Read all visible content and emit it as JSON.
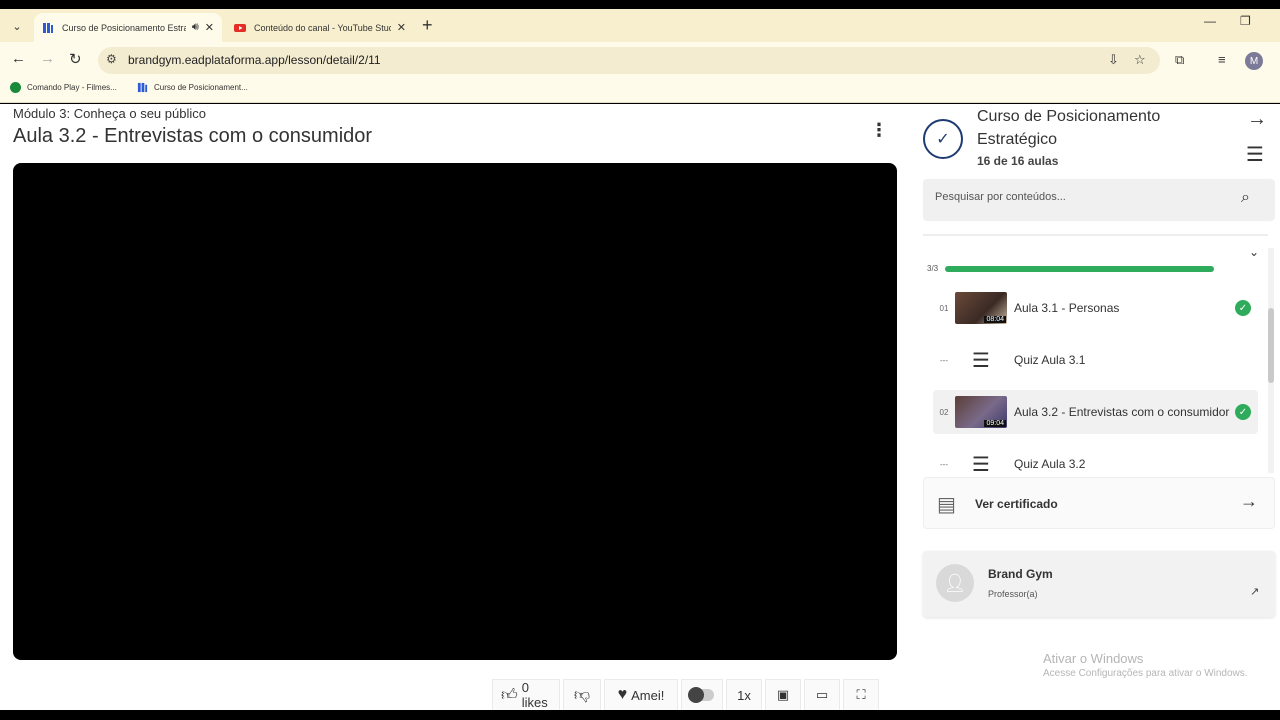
{
  "browser": {
    "tabs": [
      {
        "title": "Curso de Posicionamento Estraté",
        "active": true
      },
      {
        "title": "Conteúdo do canal - YouTube Studio",
        "active": false
      }
    ],
    "url": "brandgym.eadplataforma.app/lesson/detail/2/11",
    "profile_initial": "M",
    "bookmarks": [
      {
        "label": "Comando Play - Filmes..."
      },
      {
        "label": "Curso de Posicionament..."
      }
    ]
  },
  "lesson": {
    "module": "Módulo 3: Conheça o seu público",
    "title": "Aula 3.2 - Entrevistas com o consumidor"
  },
  "controls": {
    "likes": "0 likes",
    "love": "Amei!",
    "speed": "1x"
  },
  "course": {
    "title": "Curso de Posicionamento Estratégico",
    "count": "16 de 16 aulas",
    "search_placeholder": "Pesquisar por conteúdos...",
    "progress_label": "3/3",
    "progress_fraction": 1.0,
    "items": [
      {
        "num": "01",
        "kind": "video",
        "duration": "08:04",
        "label": "Aula 3.1 - Personas",
        "done": true,
        "selected": false
      },
      {
        "num": "---",
        "kind": "quiz",
        "label": "Quiz Aula 3.1",
        "done": false,
        "selected": false
      },
      {
        "num": "02",
        "kind": "video",
        "duration": "09:04",
        "label": "Aula 3.2 - Entrevistas com o consumidor",
        "done": true,
        "selected": true
      },
      {
        "num": "---",
        "kind": "quiz",
        "label": "Quiz Aula 3.2",
        "done": false,
        "selected": false
      }
    ],
    "certificate_label": "Ver certificado",
    "teacher": {
      "name": "Brand Gym",
      "role": "Professor(a)"
    }
  },
  "watermark": {
    "line1": "Ativar o Windows",
    "line2": "Acesse Configurações para ativar o Windows."
  },
  "colors": {
    "accent": "#1f3b73",
    "progress": "#2eac5c",
    "chrome": "#f7efce"
  }
}
